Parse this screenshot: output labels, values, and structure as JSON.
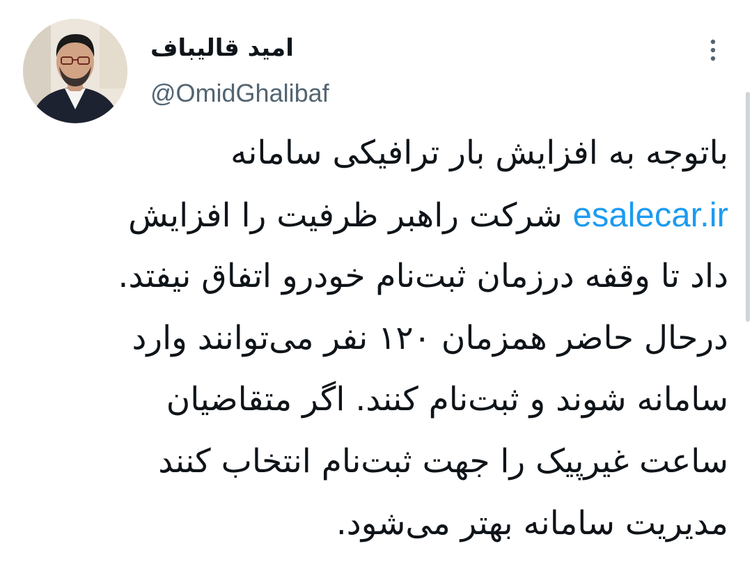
{
  "author": {
    "display_name": "امید قالیباف",
    "handle": "@OmidGhalibaf",
    "avatar_icon": "user-avatar"
  },
  "actions": {
    "more_icon": "more-vertical-icon"
  },
  "tweet": {
    "lines": [
      {
        "text": "باتوجه به افزایش بار ترافیکی سامانه"
      },
      {
        "link": "esalecar.ir",
        "text": " شرکت راهبر ظرفیت را افزایش"
      },
      {
        "text": "داد تا وقفه درزمان ثبت‌نام خودرو اتفاق نیفتد."
      },
      {
        "text": "درحال حاضر همزمان ۱۲۰ نفر می‌توانند وارد"
      },
      {
        "text": "سامانه شوند و ثبت‌نام کنند. اگر متقاضیان"
      },
      {
        "text": "ساعت غیرپیک را جهت ثبت‌نام انتخاب کنند"
      },
      {
        "text": "مدیریت سامانه بهتر می‌شود."
      }
    ]
  },
  "colors": {
    "link": "#1d9bf0",
    "secondary_text": "#536471",
    "primary_text": "#0f1419"
  }
}
